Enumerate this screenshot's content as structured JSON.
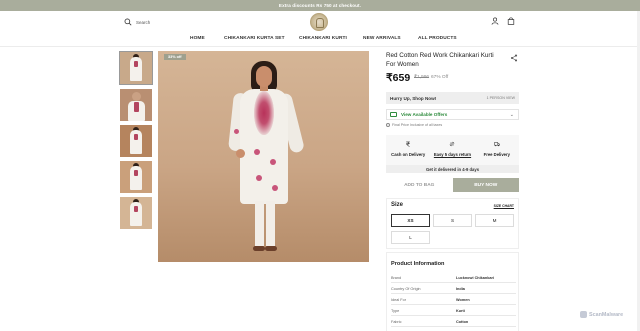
{
  "announcement": "Extra discounts Rs 750 at checkout.",
  "header": {
    "search_label": "Search",
    "icons": {
      "search": "search-icon",
      "account": "user-icon",
      "cart": "bag-icon",
      "logo": "brand-logo"
    },
    "nav": [
      "HOME",
      "CHIKANKARI KURTA SET",
      "CHIKANKARI KURTI",
      "NEW ARRIVALS",
      "ALL PRODUCTS"
    ]
  },
  "gallery": {
    "badge": "33% off",
    "thumbnail_count": 5
  },
  "product": {
    "title": "Red Cotton Red Work Chikankari Kurti For Women",
    "price": "₹659",
    "mrp": "₹1,996",
    "discount": "67% Off",
    "hurry_label": "Hurry Up, Shop Now!",
    "hurry_right": "1 PERSON VIEW",
    "offers_label": "View Available Offers",
    "tax_note": "Final Price Inclusive of all taxes",
    "features": [
      "Cash on Delivery",
      "Easy 5 days return",
      "Free Delivery"
    ],
    "delivery_note": "Get it delivered in 4-9 days",
    "add_to_bag": "ADD TO BAG",
    "buy_now": "BUY NOW"
  },
  "size": {
    "heading": "Size",
    "chart_link": "SIZE CHART",
    "options": [
      "XS",
      "S",
      "M",
      "L"
    ],
    "selected": "XS"
  },
  "info": {
    "heading": "Product Information",
    "rows": [
      {
        "k": "Brand",
        "v": "Lucknowi Chikankari"
      },
      {
        "k": "Country Of Origin",
        "v": "India"
      },
      {
        "k": "Ideal For",
        "v": "Women"
      },
      {
        "k": "Type",
        "v": "Kurti"
      },
      {
        "k": "Fabric",
        "v": "Cotton"
      }
    ]
  },
  "watermark": "ScanMalware",
  "colors": {
    "accent": "#a9ad9c",
    "green": "#2e8b3d"
  }
}
